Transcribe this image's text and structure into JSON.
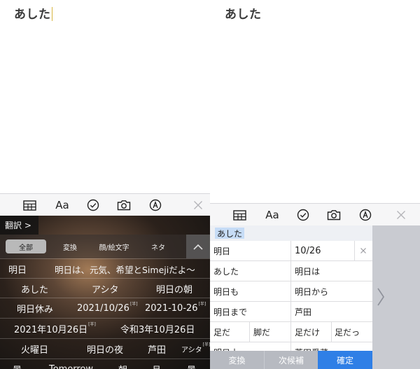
{
  "left": {
    "note_text": "あした",
    "translate_label": "翻訳 >",
    "tabs": [
      "全部",
      "変換",
      "顔/絵文字",
      "ネタ"
    ],
    "rows": [
      [
        "明日",
        "明日は、元気、希望とSimejiだよ〜"
      ],
      [
        "あした",
        "アシタ",
        "明日の朝"
      ],
      [
        "明日休み",
        "2021/10/26",
        "2021-10-26"
      ],
      [
        "2021年10月26日",
        "令和3年10月26日"
      ],
      [
        "火曜日",
        "明日の夜",
        "芦田",
        "アシタ"
      ],
      [
        "曇",
        "Tomorrow",
        "朝",
        "月",
        "曇"
      ]
    ],
    "tag": "[半]"
  },
  "right": {
    "note_text": "あした",
    "reading": "あした",
    "rows": [
      [
        "明日",
        "10/26"
      ],
      [
        "あした",
        "明日は"
      ],
      [
        "明日も",
        "明日から"
      ],
      [
        "明日まで",
        "芦田"
      ],
      [
        "足だ",
        "脚だ",
        "足だけ",
        "足だっ"
      ],
      [
        "明日十",
        "芦田愛菜"
      ]
    ],
    "buttons": {
      "convert": "変換",
      "next": "次候補",
      "confirm": "確定"
    }
  },
  "colors": {
    "confirm": "#2f7fe6",
    "secondary_button": "#b7bac1",
    "reading_highlight": "#c6dcf6",
    "cursor": "#d8b640"
  },
  "toolbar_icons": [
    "keyboard-icon",
    "text-format-icon",
    "check-circle-icon",
    "camera-icon",
    "markup-pen-icon",
    "close-icon"
  ]
}
